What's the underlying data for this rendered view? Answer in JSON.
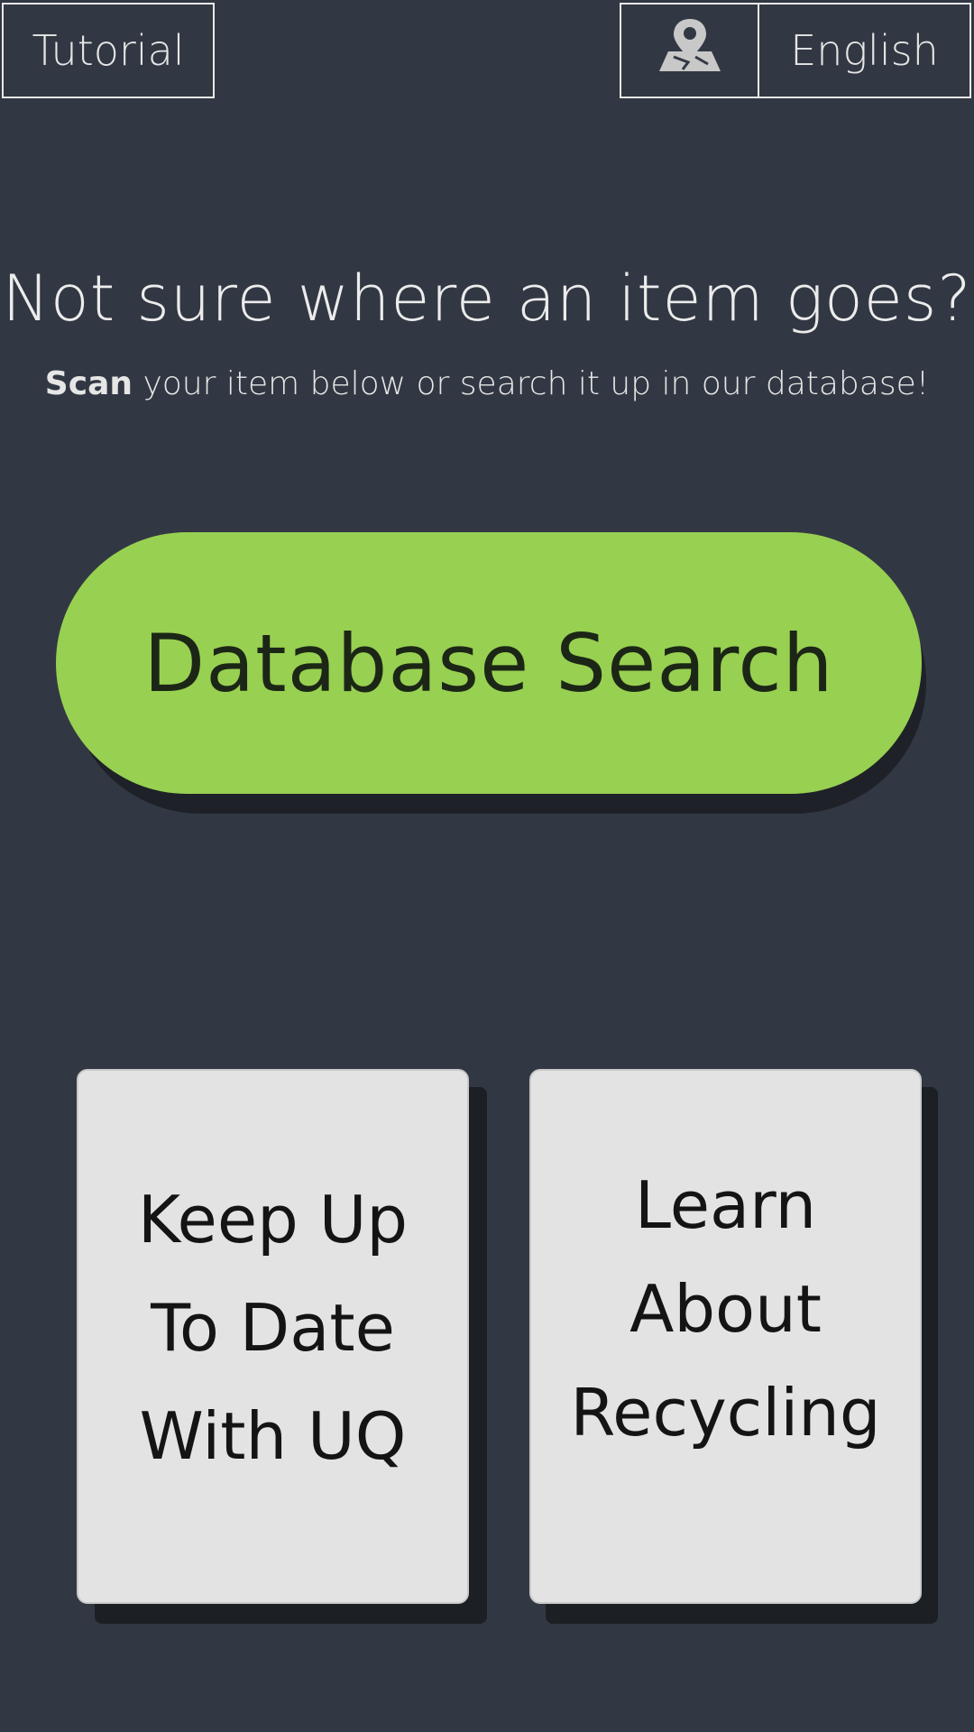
{
  "header": {
    "tutorial_label": "Tutorial",
    "map_icon": "map-pin-icon",
    "language_label": "English"
  },
  "hero": {
    "headline": "Not sure where an item goes?",
    "sub_bold": "Scan",
    "sub_rest": " your item below or search it up in our database!"
  },
  "search": {
    "label": "Database Search"
  },
  "cards": [
    {
      "lines": [
        "Keep Up",
        "To Date",
        "With UQ"
      ]
    },
    {
      "lines": [
        "Learn",
        "About",
        "Recycling"
      ]
    }
  ],
  "colors": {
    "background": "#323843",
    "accent_green": "#98d051",
    "card_bg": "#e3e3e3",
    "text_light": "#e6e6e6"
  }
}
